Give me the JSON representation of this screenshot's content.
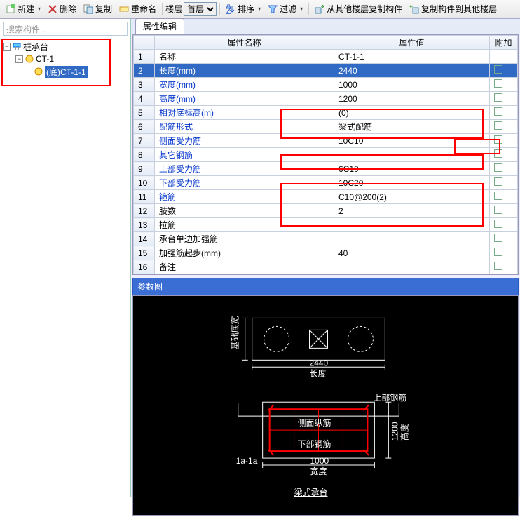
{
  "toolbar": {
    "new": "新建",
    "delete": "删除",
    "copy": "复制",
    "rename": "重命名",
    "floor": "楼层",
    "floor_sel": "首层",
    "sort": "排序",
    "filter": "过滤",
    "copy_from": "从其他楼层复制构件",
    "copy_to": "复制构件到其他楼层"
  },
  "search_placeholder": "搜索构件...",
  "tree": {
    "root": "桩承台",
    "child": "CT-1",
    "leaf": "(底)CT-1-1"
  },
  "tab": "属性编辑",
  "grid": {
    "headers": {
      "name": "属性名称",
      "value": "属性值",
      "add": "附加"
    },
    "rows": [
      {
        "n": "1",
        "name": "名称",
        "val": "CT-1-1",
        "link": false
      },
      {
        "n": "2",
        "name": "长度(mm)",
        "val": "2440",
        "link": true,
        "sel": true
      },
      {
        "n": "3",
        "name": "宽度(mm)",
        "val": "1000",
        "link": true
      },
      {
        "n": "4",
        "name": "高度(mm)",
        "val": "1200",
        "link": true
      },
      {
        "n": "5",
        "name": "相对底标高(m)",
        "val": "(0)",
        "link": true
      },
      {
        "n": "6",
        "name": "配筋形式",
        "val": "梁式配筋",
        "link": true
      },
      {
        "n": "7",
        "name": "侧面受力筋",
        "val": "10C10",
        "link": true
      },
      {
        "n": "8",
        "name": "其它钢筋",
        "val": "",
        "link": true
      },
      {
        "n": "9",
        "name": "上部受力筋",
        "val": "6C10",
        "link": true
      },
      {
        "n": "10",
        "name": "下部受力筋",
        "val": "10C20",
        "link": true
      },
      {
        "n": "11",
        "name": "箍筋",
        "val": "C10@200(2)",
        "link": true
      },
      {
        "n": "12",
        "name": "肢数",
        "val": "2",
        "link": false
      },
      {
        "n": "13",
        "name": "拉筋",
        "val": "",
        "link": false
      },
      {
        "n": "14",
        "name": "承台单边加强筋",
        "val": "",
        "link": false
      },
      {
        "n": "15",
        "name": "加强筋起步(mm)",
        "val": "40",
        "link": false
      },
      {
        "n": "16",
        "name": "备注",
        "val": "",
        "link": false
      }
    ]
  },
  "param_title": "参数图",
  "diagram": {
    "d1": "2440",
    "d1_label": "长度",
    "d2": "1200",
    "d2_label": "高度",
    "d3": "1000",
    "d3_label": "宽度",
    "side_label": "基础底宽",
    "top_rebar": "上部钢筋",
    "side_rebar": "侧面纵筋",
    "bot_rebar": "下部钢筋",
    "hatch": "1a-1a",
    "caption": "梁式承台"
  }
}
